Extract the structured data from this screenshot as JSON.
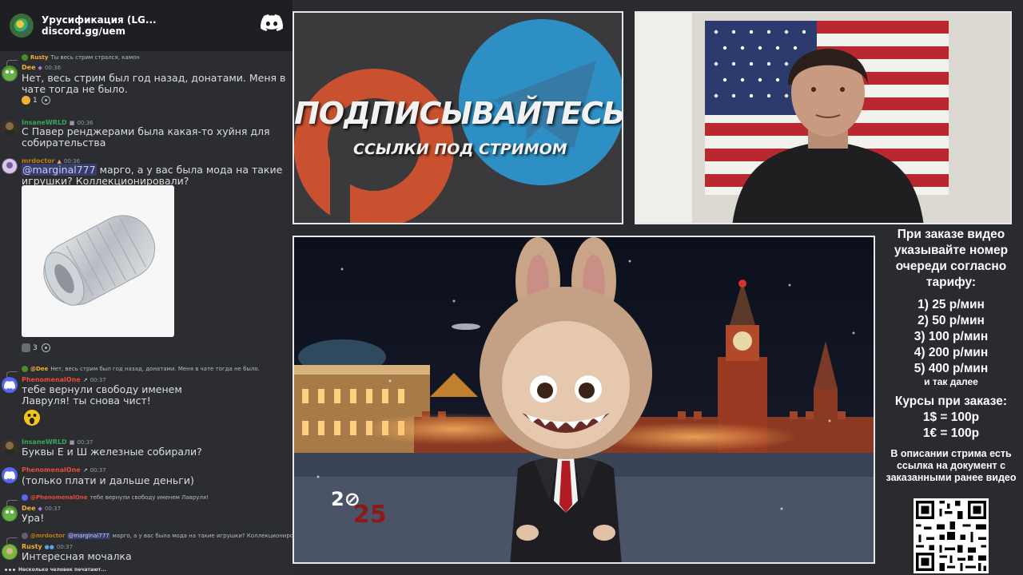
{
  "discord": {
    "server_name": "Урусификация (LG...",
    "invite": "discord.gg/uem"
  },
  "messages": [
    {
      "kind": "reply",
      "reply_user": "Rusty",
      "reply_text": "Ты весь стрим стрался, камон"
    },
    {
      "kind": "msg",
      "user": "Dee",
      "user_color": "#f0b132",
      "time": "00:36",
      "text": "Нет, весь стрим был год назад, донатами. Меня в чате тогда не было.",
      "reaction_count": "1"
    },
    {
      "kind": "msg",
      "user": "InsaneWRLD",
      "user_color": "#3ba55c",
      "time": "00:36",
      "text": "С Павер ренджерами была какая-то хуйня для собирательства"
    },
    {
      "kind": "msg",
      "user": "mrdoctor",
      "user_color": "#c27c0e",
      "time": "00:36",
      "mention": "@marginal777",
      "text": "марго, а у вас была мода на такие игрушки? Коллекционировали?",
      "reaction_count": "3"
    },
    {
      "kind": "reply",
      "reply_user": "@Dee",
      "reply_text": "Нет, весь стрим был год назад, донатами. Меня в чате тогда не было."
    },
    {
      "kind": "msg",
      "user": "PhenomenalOne",
      "user_color": "#e74c3c",
      "time": "00:37",
      "text": "тебе вернули свободу именем Лавруля! ты снова чист!"
    },
    {
      "kind": "msg",
      "user": "InsaneWRLD",
      "user_color": "#3ba55c",
      "time": "00:37",
      "text": "Буквы Е и Ш железные собирали?"
    },
    {
      "kind": "msg",
      "user": "PhenomenalOne",
      "user_color": "#e74c3c",
      "time": "00:37",
      "text": "(только плати и дальше деньги)"
    },
    {
      "kind": "reply",
      "reply_user": "@PhenomenalOne",
      "reply_text": "тебе вернули свободу именем Лавруля!"
    },
    {
      "kind": "msg",
      "user": "Dee",
      "user_color": "#f0b132",
      "time": "00:37",
      "text": "Ура!"
    },
    {
      "kind": "reply",
      "reply_user": "@mrdoctor",
      "reply_mention": "@marginal777",
      "reply_text": "марго, а у вас была мода на такие игрушки? Коллекционировали?"
    },
    {
      "kind": "msg",
      "user": "Rusty",
      "user_color": "#f0b132",
      "time": "00:37",
      "text": "Интересная мочалка"
    }
  ],
  "typing": "Несколько человек печатают...",
  "promo": {
    "title": "ПОДПИСЫВАЙТЕСЬ",
    "subtitle": "ССЫЛКИ ПОД СТРИМОМ"
  },
  "video": {
    "year_a": "2⊘",
    "year_b": "25"
  },
  "info": {
    "heading": "При заказе видео указывайте номер очереди согласно тарифу:",
    "rates": [
      "1) 25 р/мин",
      "2) 50 р/мин",
      "3) 100 р/мин",
      "4) 200 р/мин",
      "5) 400 р/мин"
    ],
    "rates_more": "и так далее",
    "fx_title": "Курсы при заказе:",
    "fx": [
      "1$ = 100р",
      "1€ = 100р"
    ],
    "description": "В описании стрима есть ссылка на документ с заказанными ранее видео"
  },
  "colors": {
    "discord_bg": "#2b2d31",
    "discord_header": "#1e1f22",
    "blurple": "#5865f2",
    "patreon_orange": "#e0603c",
    "telegram_blue": "#2aa4e0"
  }
}
